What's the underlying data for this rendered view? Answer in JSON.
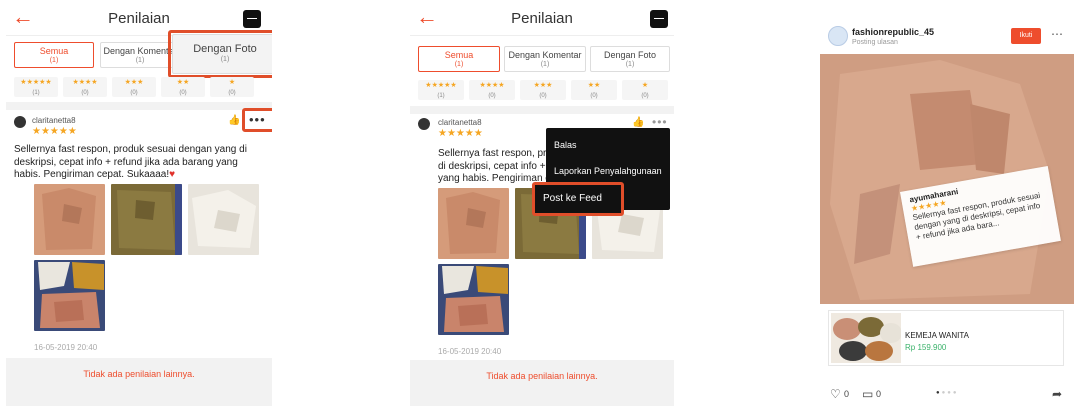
{
  "colors": {
    "accent": "#ee4d2d",
    "highlight": "#e04e2a",
    "star": "#f5a623",
    "price": "#3ab26a"
  },
  "header": {
    "title": "Penilaian",
    "back_icon": "arrow-left-icon",
    "chat_icon": "chat-icon"
  },
  "tabs": [
    {
      "label": "Semua",
      "count": "(1)"
    },
    {
      "label": "Dengan Komentar",
      "count": "(1)"
    },
    {
      "label": "Dengan Foto",
      "count": "(1)"
    }
  ],
  "star_filters": [
    {
      "stars": "★★★★★",
      "count": "(1)"
    },
    {
      "stars": "★★★★",
      "count": "(0)"
    },
    {
      "stars": "★★★",
      "count": "(0)"
    },
    {
      "stars": "★★",
      "count": "(0)"
    },
    {
      "stars": "★",
      "count": "(0)"
    }
  ],
  "review": {
    "username": "clarita­netta8",
    "rating": 5,
    "stars": "★★★★★",
    "text": "Sellernya fast respon, produk sesuai dengan yang di deskripsi, cepat info + refund jika ada barang yang habis. Pengiriman cepat. Sukaaaa!",
    "date": "16-05-2019 20:40",
    "more_icon": "•••"
  },
  "footer": {
    "no_more": "Tidak ada penilaian lainnya."
  },
  "menu": {
    "items": [
      "Balas",
      "Laporkan Penyalahgunaan"
    ],
    "post_feed": "Post ke Feed"
  },
  "feed": {
    "account": "fashionrepublic_45",
    "subtitle": "Posting ulasan",
    "follow_label": "Ikuti",
    "overlay": {
      "username": "ayumaharani",
      "stars": "★★★★★",
      "text": "Sellernya fast respon, produk sesuai dengan yang di deskripsi, cepat info + refund jika ada bara..."
    },
    "product": {
      "name": "KEMEJA WANITA",
      "price": "Rp 159.900"
    },
    "likes": "0",
    "comments": "0"
  }
}
